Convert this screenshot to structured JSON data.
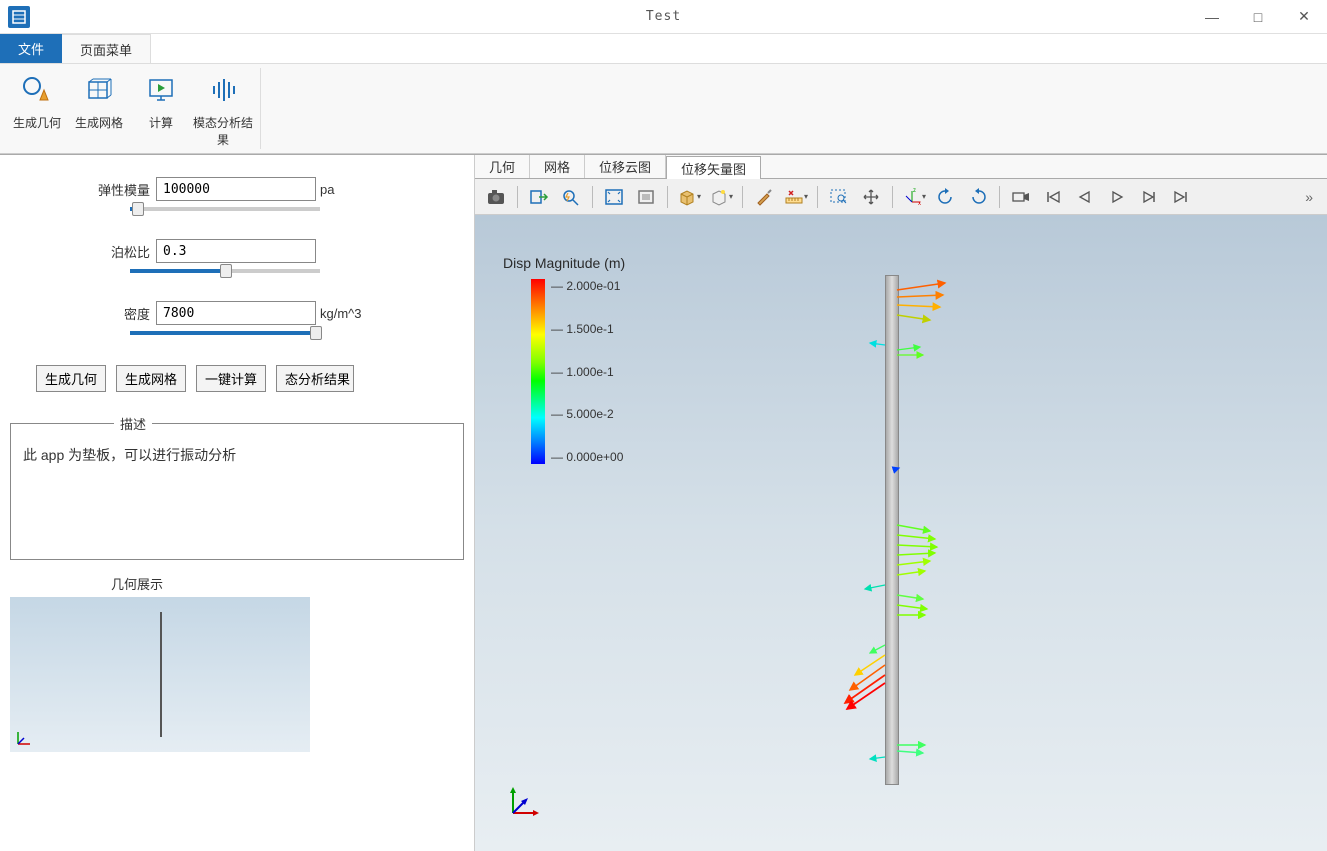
{
  "window": {
    "title": "Test"
  },
  "menu": {
    "file": "文件",
    "page": "页面菜单"
  },
  "ribbon": {
    "gen_geom": "生成几何",
    "gen_mesh": "生成网格",
    "compute": "计算",
    "modal_results": "模态分析结果"
  },
  "fields": {
    "elastic_modulus": {
      "label": "弹性模量",
      "value": "100000",
      "unit": "pa"
    },
    "poisson": {
      "label": "泊松比",
      "value": "0.3",
      "unit": ""
    },
    "density": {
      "label": "密度",
      "value": "7800",
      "unit": "kg/m^3"
    }
  },
  "buttons": {
    "gen_geom": "生成几何",
    "gen_mesh": "生成网格",
    "one_click": "一键计算",
    "modal": "态分析结果"
  },
  "desc": {
    "title": "描述",
    "text": "此 app 为垫板，可以进行振动分析"
  },
  "geom_preview": {
    "title": "几何展示"
  },
  "view_tabs": {
    "geom": "几何",
    "mesh": "网格",
    "disp_cloud": "位移云图",
    "disp_vector": "位移矢量图"
  },
  "legend": {
    "title": "Disp Magnitude (m)",
    "ticks": [
      "2.000e-01",
      "1.500e-1",
      "1.000e-1",
      "5.000e-2",
      "0.000e+00"
    ]
  },
  "chart_data": {
    "type": "vector_field",
    "title": "Disp Magnitude (m)",
    "scalar_range": [
      0.0,
      0.2
    ],
    "colormap": "rainbow",
    "ticks": [
      0.0,
      0.05,
      0.1,
      0.15,
      0.2
    ]
  }
}
